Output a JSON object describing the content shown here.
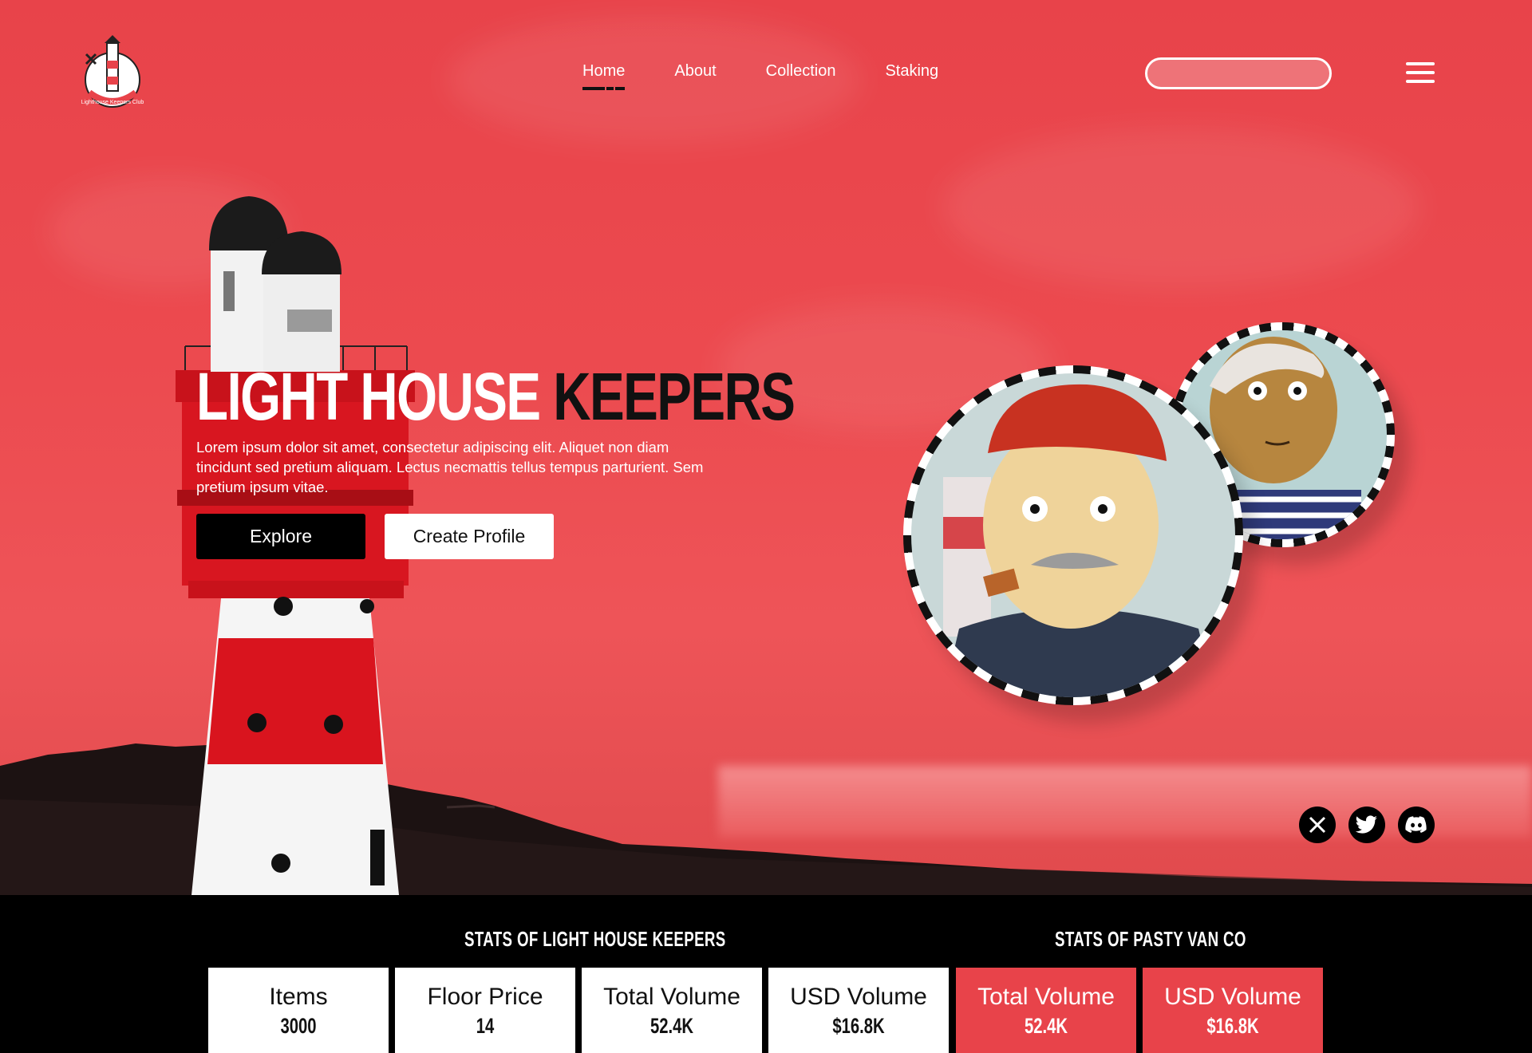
{
  "brand": {
    "logo_text": "Lighthouse Keepers Club"
  },
  "nav": {
    "items": [
      "Home",
      "About",
      "Collection",
      "Staking"
    ],
    "active": "Home"
  },
  "search": {
    "placeholder": ""
  },
  "hero": {
    "title_white": "LIGHT HOUSE",
    "title_black": "KEEPERS",
    "lead": "Lorem ipsum dolor sit amet, consectetur adipiscing elit. Aliquet non diam tincidunt sed pretium aliquam. Lectus necmattis tellus tempus parturient. Sem pretium ipsum vitae.",
    "explore_label": "Explore",
    "create_label": "Create Profile"
  },
  "social": [
    "x-icon",
    "twitter-icon",
    "discord-icon"
  ],
  "stats": {
    "group1_title": "STATS OF LIGHT HOUSE KEEPERS",
    "group2_title": "STATS OF PASTY VAN CO",
    "cards": [
      {
        "label": "Items",
        "value": "3000"
      },
      {
        "label": "Floor Price",
        "value": "14"
      },
      {
        "label": "Total Volume",
        "value": "52.4K"
      },
      {
        "label": "USD Volume",
        "value": "$16.8K"
      },
      {
        "label": "Total Volume",
        "value": "52.4K"
      },
      {
        "label": "USD Volume",
        "value": "$16.8K"
      }
    ]
  },
  "colors": {
    "accent": "#e8434a",
    "dark": "#000000",
    "light": "#ffffff"
  }
}
